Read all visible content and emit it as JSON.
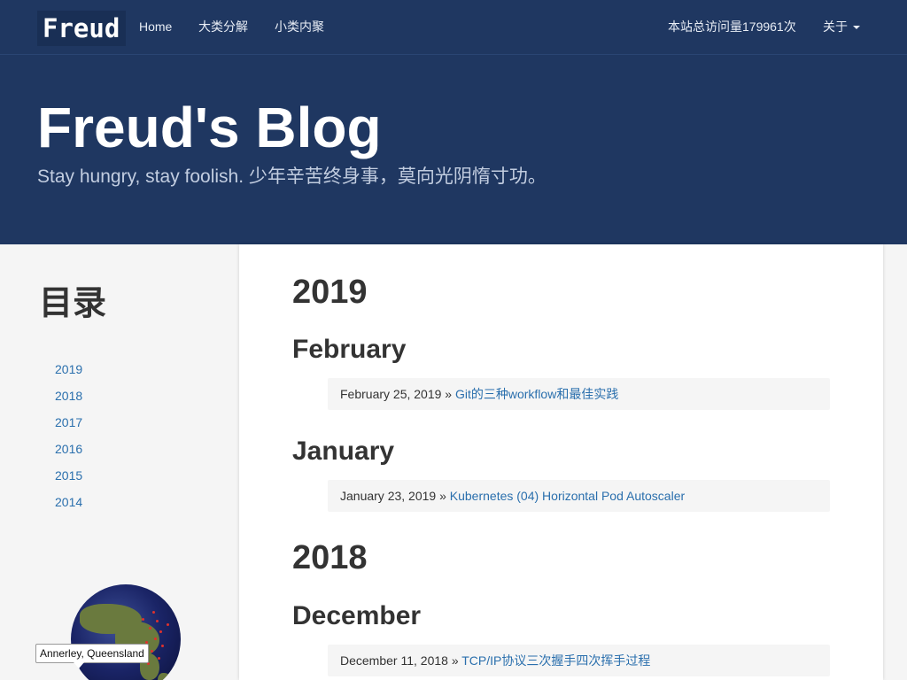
{
  "navbar": {
    "brand": "Freud",
    "links": [
      "Home",
      "大类分解",
      "小类内聚"
    ],
    "visits": "本站总访问量179961次",
    "about": "关于"
  },
  "header": {
    "title": "Freud's Blog",
    "subtitle": "Stay hungry, stay foolish. 少年辛苦终身事，莫向光阴惰寸功。"
  },
  "sidebar": {
    "title": "目录",
    "years": [
      "2019",
      "2018",
      "2017",
      "2016",
      "2015",
      "2014"
    ],
    "globe_label": "Annerley, Queensland"
  },
  "main": {
    "sections": [
      {
        "year": "2019"
      },
      {
        "month": "February",
        "date": "February 25, 2019 »",
        "title": "Git的三种workflow和最佳实践"
      },
      {
        "month": "January",
        "date": "January 23, 2019 »",
        "title": "Kubernetes (04) Horizontal Pod Autoscaler"
      },
      {
        "year": "2018"
      },
      {
        "month": "December",
        "date": "December 11, 2018 »",
        "title": "TCP/IP协议三次握手四次挥手过程"
      }
    ]
  }
}
